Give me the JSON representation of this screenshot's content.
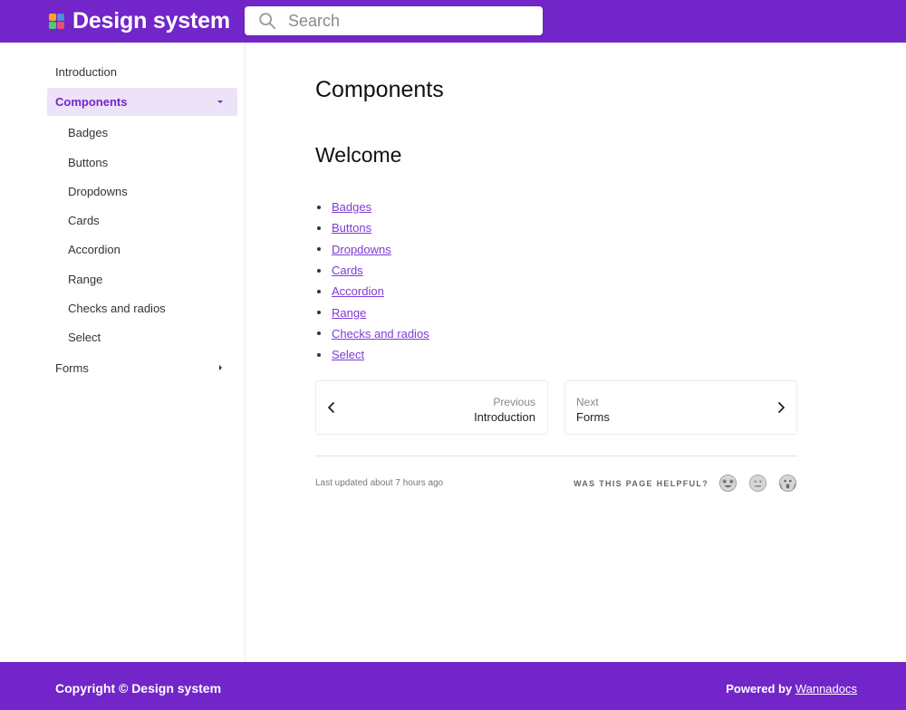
{
  "header": {
    "title": "Design system",
    "logo_colors": [
      "#f5a623",
      "#4a90e2",
      "#50c878",
      "#e94e77"
    ],
    "search_placeholder": "Search"
  },
  "sidebar": {
    "items": [
      {
        "label": "Introduction"
      },
      {
        "label": "Components",
        "active": true,
        "expanded": true
      },
      {
        "label": "Forms",
        "expanded": false
      }
    ],
    "subitems": [
      "Badges",
      "Buttons",
      "Dropdowns",
      "Cards",
      "Accordion",
      "Range",
      "Checks and radios",
      "Select"
    ]
  },
  "main": {
    "title": "Components",
    "section_title": "Welcome",
    "links": [
      "Badges",
      "Buttons",
      "Dropdowns",
      "Cards",
      "Accordion",
      "Range",
      "Checks and radios",
      "Select"
    ],
    "pager": {
      "prev_label": "Previous",
      "prev_title": "Introduction",
      "next_label": "Next",
      "next_title": "Forms"
    },
    "last_updated": "Last updated about 7 hours ago",
    "helpful_prompt": "WAS THIS PAGE HELPFUL?"
  },
  "footer": {
    "copyright": "Copyright © Design system",
    "powered_by": "Powered by",
    "powered_link": "Wannadocs"
  },
  "colors": {
    "brand": "#7226c9",
    "active_bg": "#ede3f8",
    "link": "#7e3bd6"
  }
}
